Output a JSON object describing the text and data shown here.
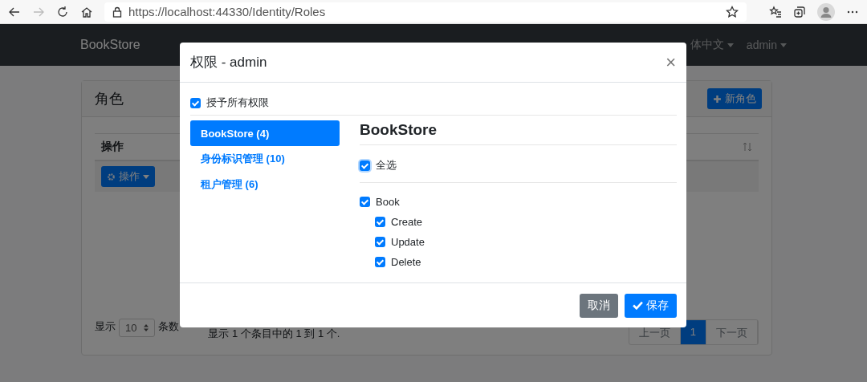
{
  "browser": {
    "url": "https://localhost:44330/Identity/Roles"
  },
  "navbar": {
    "brand": "BookStore",
    "language": "体中文",
    "user": "admin"
  },
  "page": {
    "card_title": "角色",
    "new_button": "新角色",
    "columns": [
      {
        "label": "操作"
      }
    ],
    "rows": [
      {
        "action_button": "操作"
      }
    ],
    "page_size_prefix": "显示",
    "page_size": "10",
    "page_size_suffix": "条数",
    "info": "显示 1 个条目中的 1 到 1 个.",
    "pagination": [
      {
        "label": "上一页",
        "selected": false
      },
      {
        "label": "1",
        "selected": true
      },
      {
        "label": "下一页",
        "selected": false
      }
    ]
  },
  "dialog": {
    "title": "权限 - admin",
    "close": "×",
    "grant_all": {
      "label": "授予所有权限",
      "checked": true
    },
    "groups": [
      {
        "label": "BookStore (4)",
        "selected": true
      },
      {
        "label": "身份标识管理 (10)",
        "selected": false
      },
      {
        "label": "租户管理 (6)",
        "selected": false
      }
    ],
    "pane_title": "BookStore",
    "select_all": {
      "label": "全选",
      "checked": true
    },
    "permissions": [
      {
        "label": "Book",
        "checked": true,
        "children": [
          {
            "label": "Create",
            "checked": true
          },
          {
            "label": "Update",
            "checked": true
          },
          {
            "label": "Delete",
            "checked": true
          }
        ]
      }
    ],
    "buttons": [
      {
        "kind": "secondary",
        "label": "取消"
      },
      {
        "kind": "primary",
        "label": "保存"
      }
    ]
  }
}
